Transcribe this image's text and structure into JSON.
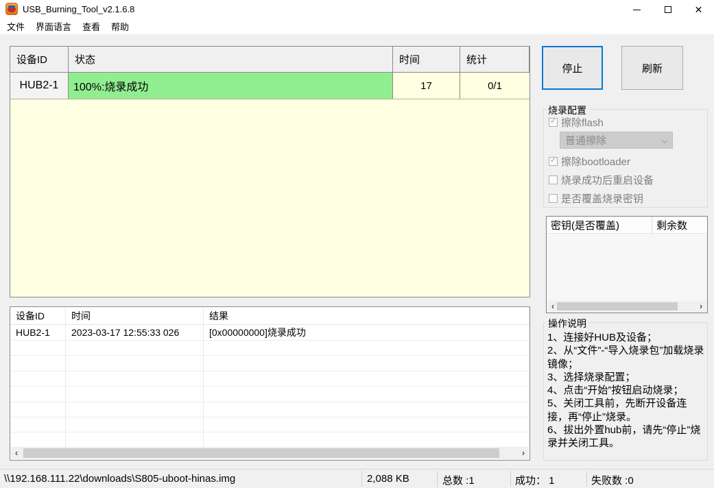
{
  "window": {
    "title": "USB_Burning_Tool_v2.1.6.8"
  },
  "icons": {
    "close": "✕",
    "check": "✓",
    "scroll_left": "‹",
    "scroll_right": "›"
  },
  "menu": {
    "items": [
      {
        "label": "文件"
      },
      {
        "label": "界面语言"
      },
      {
        "label": "查看"
      },
      {
        "label": "帮助"
      }
    ]
  },
  "device_table": {
    "headers": {
      "device_id": "设备ID",
      "status": "状态",
      "time": "时间",
      "stats": "统计"
    },
    "rows": [
      {
        "device_id": "HUB2-1",
        "status": "100%:烧录成功",
        "time": "17",
        "stats": "0/1"
      }
    ]
  },
  "actions": {
    "stop": "停止",
    "refresh": "刷新"
  },
  "burn_config": {
    "title": "烧录配置",
    "erase_flash": {
      "label": "擦除flash",
      "checked": true
    },
    "erase_mode": {
      "value": "普通擦除"
    },
    "erase_bootloader": {
      "label": "擦除bootloader",
      "checked": true
    },
    "reboot_after": {
      "label": "烧录成功后重启设备",
      "checked": false
    },
    "overwrite_key": {
      "label": "是否覆盖烧录密钥",
      "checked": false
    }
  },
  "key_table": {
    "headers": {
      "key": "密钥(是否覆盖)",
      "remaining": "剩余数"
    },
    "rows": []
  },
  "instructions": {
    "title": "操作说明",
    "lines": [
      "1、连接好HUB及设备；",
      "2、从“文件”-“导入烧录包”加载烧录镜像；",
      "3、选择烧录配置；",
      "4、点击“开始”按钮启动烧录；",
      "5、关闭工具前，先断开设备连接，再“停止”烧录。",
      "6、拔出外置hub前，请先“停止”烧录并关闭工具。"
    ]
  },
  "log_table": {
    "headers": {
      "device_id": "设备ID",
      "time": "时间",
      "result": "结果"
    },
    "rows": [
      {
        "device_id": "HUB2-1",
        "time": "2023-03-17 12:55:33 026",
        "result": "[0x00000000]烧录成功"
      }
    ]
  },
  "status_bar": {
    "image_path": "\\\\192.168.111.22\\downloads\\S805-uboot-hinas.img",
    "size": "2,088 KB",
    "total": "总数 :1",
    "success": "成功： 1",
    "failed": "失败数 :0"
  },
  "colors": {
    "success_green": "#90EE90",
    "table_yellow": "#FFFFE1",
    "focus_blue": "#0078D7",
    "panel_gray": "#F0F0F0"
  }
}
